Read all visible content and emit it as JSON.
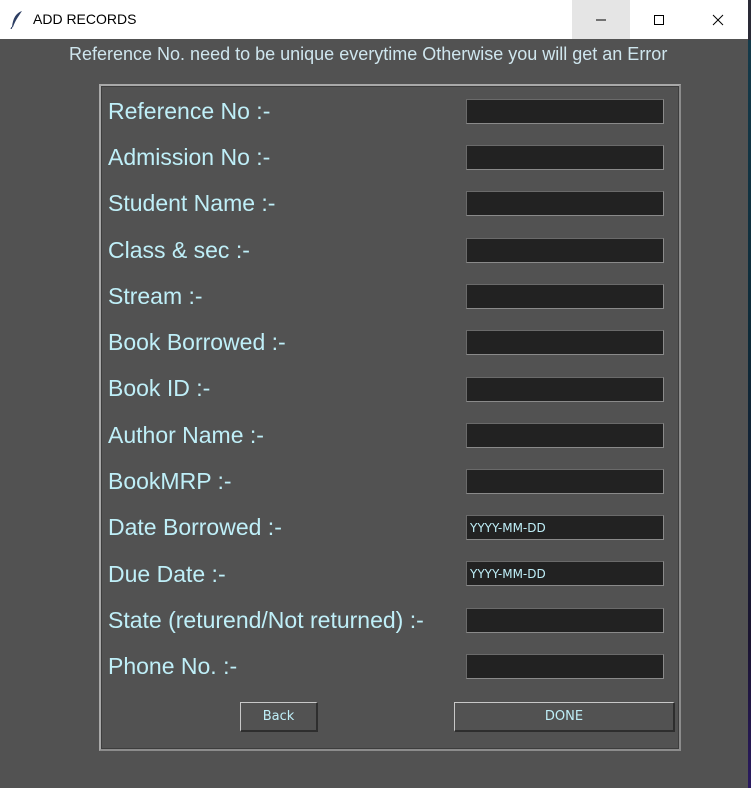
{
  "window": {
    "title": "ADD RECORDS",
    "icon": "feather-icon"
  },
  "notice": "Reference No. need to be unique everytime Otherwise you will get an Error",
  "fields": [
    {
      "label": "Reference No :-",
      "value": ""
    },
    {
      "label": "Admission No :-",
      "value": ""
    },
    {
      "label": "Student Name :-",
      "value": ""
    },
    {
      "label": "Class & sec :-",
      "value": ""
    },
    {
      "label": "Stream :-",
      "value": ""
    },
    {
      "label": "Book Borrowed :-",
      "value": ""
    },
    {
      "label": "Book ID :-",
      "value": ""
    },
    {
      "label": "Author Name :-",
      "value": ""
    },
    {
      "label": "BookMRP :-",
      "value": ""
    },
    {
      "label": "Date Borrowed :-",
      "value": "YYYY-MM-DD"
    },
    {
      "label": "Due Date :-",
      "value": "YYYY-MM-DD"
    },
    {
      "label": "State (returend/Not returned) :-",
      "value": ""
    },
    {
      "label": "Phone No. :-",
      "value": ""
    }
  ],
  "buttons": {
    "back": "Back",
    "done": "DONE"
  },
  "colors": {
    "background": "#525252",
    "text": "#bfeff8",
    "input_bg": "#222222"
  }
}
